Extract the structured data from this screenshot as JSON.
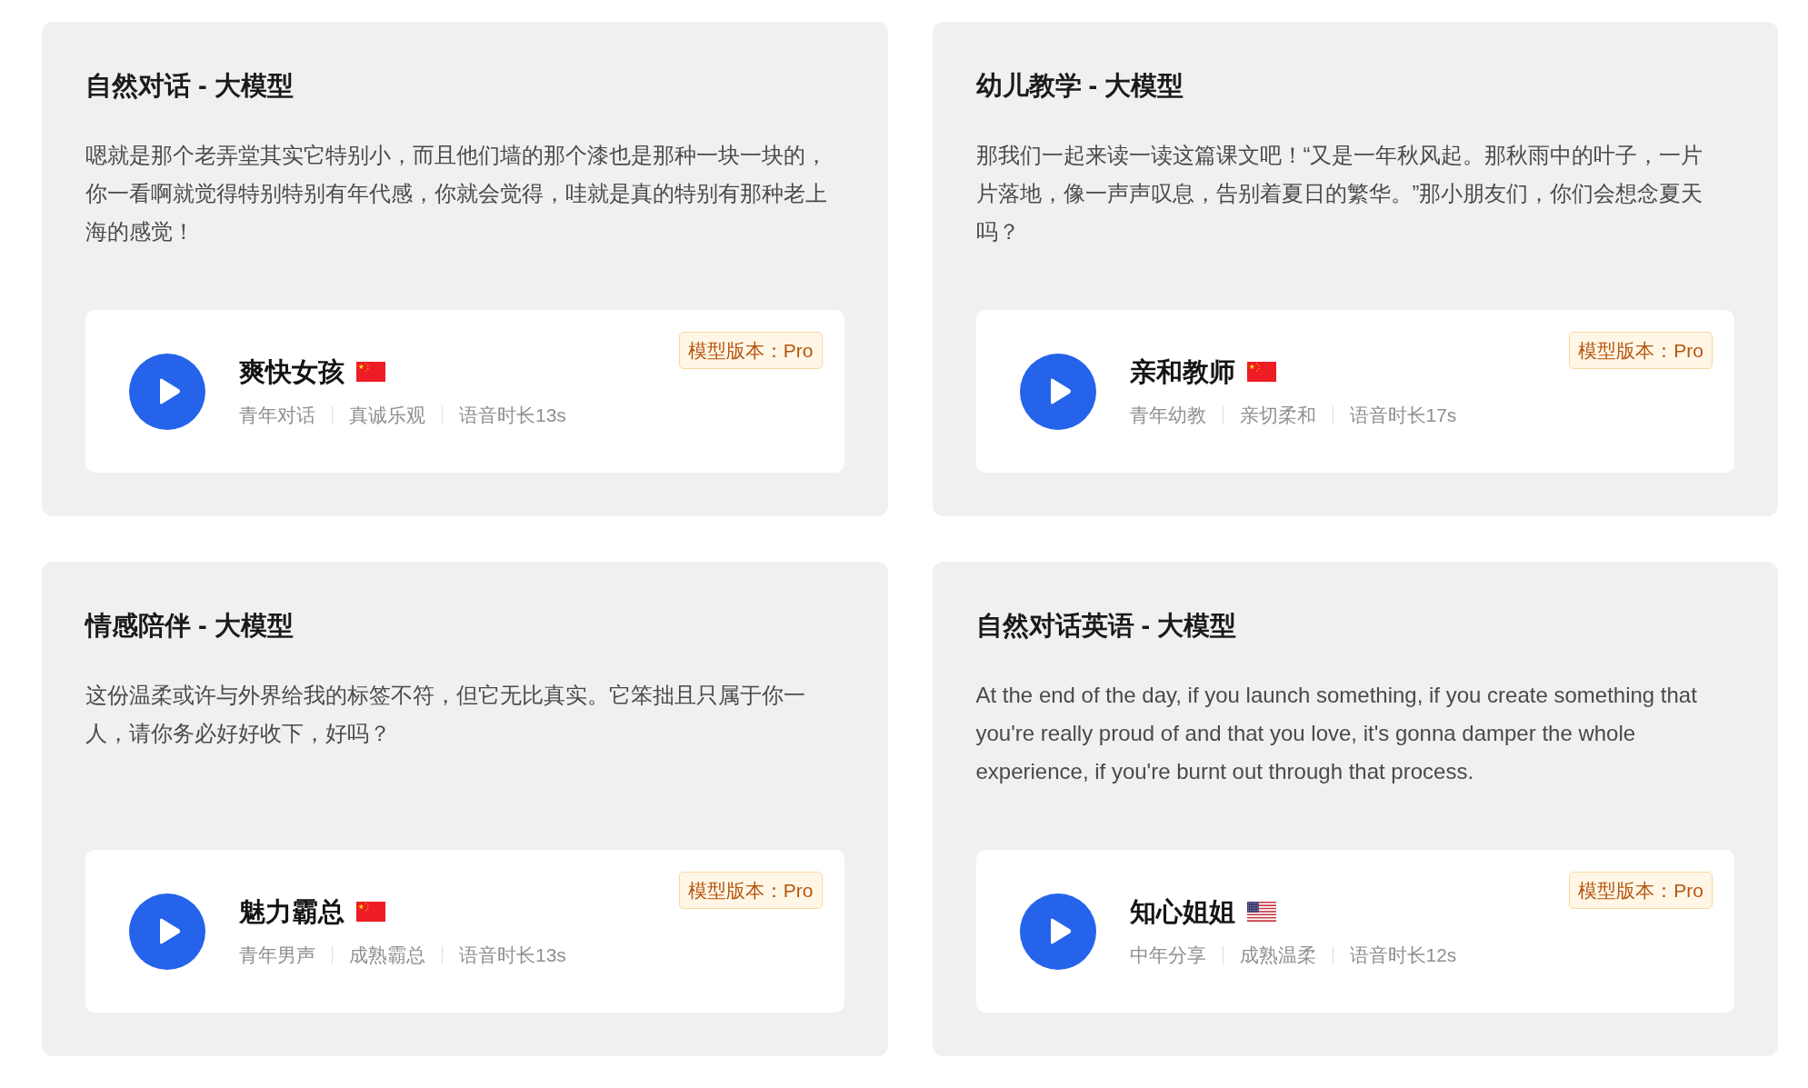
{
  "cards": [
    {
      "title": "自然对话 - 大模型",
      "description": "嗯就是那个老弄堂其实它特别小，而且他们墙的那个漆也是那种一块一块的，你一看啊就觉得特别特别有年代感，你就会觉得，哇就是真的特别有那种老上海的感觉！",
      "voice": {
        "name": "爽快女孩",
        "flag": {
          "kind": "cn"
        },
        "tags": [
          "青年对话",
          "真诚乐观",
          "语音时长13s"
        ],
        "badge": "模型版本：Pro"
      }
    },
    {
      "title": "幼儿教学 - 大模型",
      "description": "那我们一起来读一读这篇课文吧！“又是一年秋风起。那秋雨中的叶子，一片片落地，像一声声叹息，告别着夏日的繁华。”那小朋友们，你们会想念夏天吗？",
      "voice": {
        "name": "亲和教师",
        "flag": {
          "kind": "cn"
        },
        "tags": [
          "青年幼教",
          "亲切柔和",
          "语音时长17s"
        ],
        "badge": "模型版本：Pro"
      }
    },
    {
      "title": "情感陪伴 - 大模型",
      "description": "这份温柔或许与外界给我的标签不符，但它无比真实。它笨拙且只属于你一人，请你务必好好收下，好吗？",
      "voice": {
        "name": "魅力霸总",
        "flag": {
          "kind": "cn"
        },
        "tags": [
          "青年男声",
          "成熟霸总",
          "语音时长13s"
        ],
        "badge": "模型版本：Pro"
      }
    },
    {
      "title": "自然对话英语 - 大模型",
      "description": "At the end of the day, if you launch something, if you create something that you're really proud of and that you love, it's gonna damper the whole experience, if you're burnt out through that process.",
      "voice": {
        "name": "知心姐姐",
        "flag": {
          "kind": "us"
        },
        "tags": [
          "中年分享",
          "成熟温柔",
          "语音时长12s"
        ],
        "badge": "模型版本：Pro"
      }
    }
  ]
}
